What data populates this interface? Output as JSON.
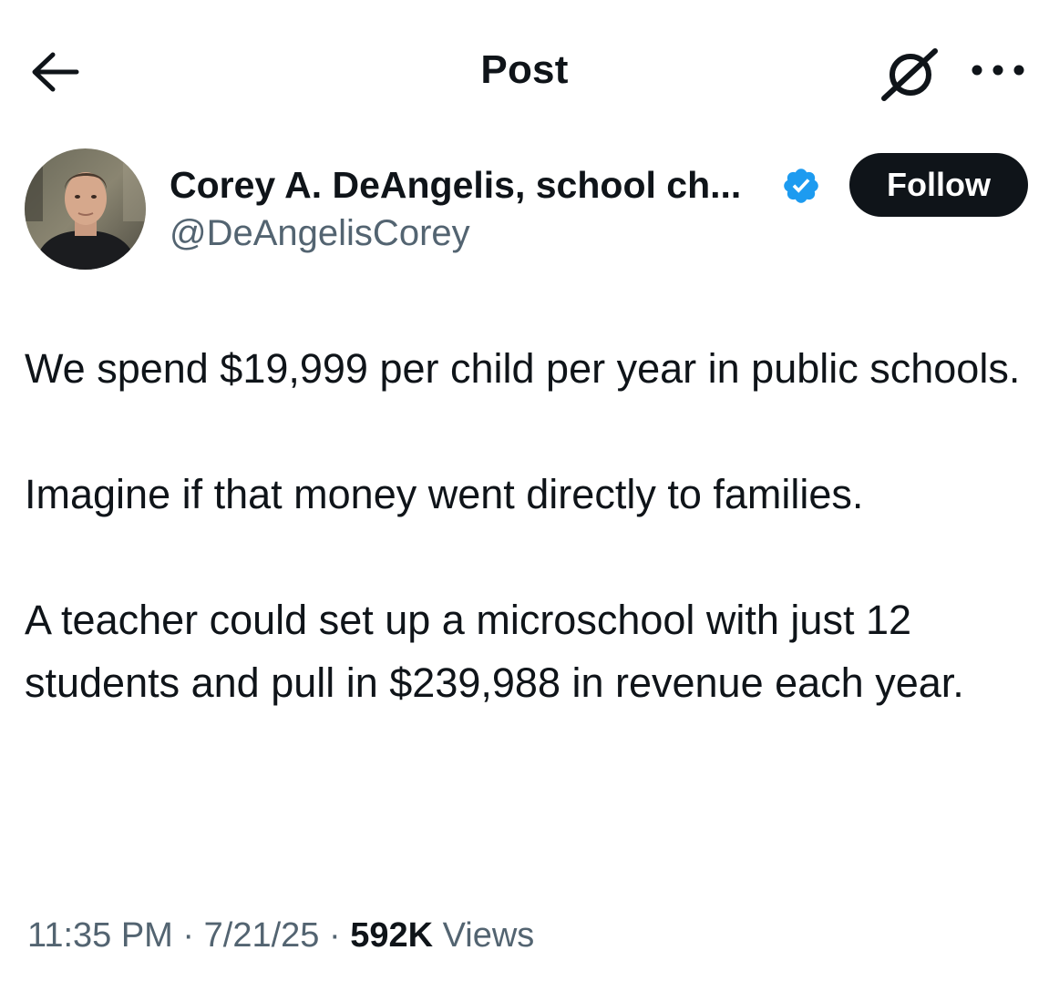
{
  "header": {
    "title": "Post",
    "back_icon": "arrow-left-icon",
    "grok_icon": "grok-icon",
    "more_icon": "more-horizontal-icon"
  },
  "author": {
    "display_name": "Corey A. DeAngelis, school ch...",
    "handle": "@DeAngelisCorey",
    "verified": true,
    "verified_color": "#1d9bf0",
    "follow_label": "Follow"
  },
  "tweet": {
    "paragraphs": [
      "We spend $19,999 per child per year in public schools.",
      "Imagine if that money went directly to families.",
      "A teacher could set up a microschool with just 12 students and pull in $239,988 in revenue each year."
    ]
  },
  "meta": {
    "time": "11:35 PM",
    "separator": "·",
    "date": "7/21/25",
    "views_count": "592K",
    "views_label": "Views"
  },
  "colors": {
    "text": "#0f1419",
    "secondary_text": "#536471",
    "accent": "#1d9bf0",
    "follow_bg": "#0f1419"
  }
}
